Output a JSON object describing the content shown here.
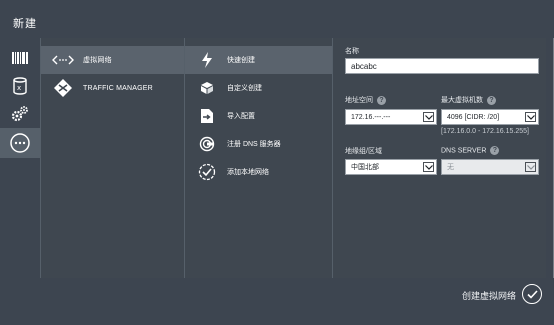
{
  "window": {
    "title": "新建"
  },
  "sidebar_icons": [
    {
      "name": "barcode-icon",
      "active": false
    },
    {
      "name": "cylinder-icon",
      "active": false
    },
    {
      "name": "gears-icon",
      "active": false
    },
    {
      "name": "network-dots-icon",
      "active": true
    }
  ],
  "nav": {
    "items": [
      {
        "label": "虚拟网络",
        "icon": "network-arrows-icon",
        "active": true
      },
      {
        "label": "TRAFFIC MANAGER",
        "icon": "traffic-manager-icon",
        "active": false
      }
    ]
  },
  "actions": {
    "items": [
      {
        "label": "快速创建",
        "icon": "lightning-icon",
        "active": true
      },
      {
        "label": "自定义创建",
        "icon": "box-icon",
        "active": false
      },
      {
        "label": "导入配置",
        "icon": "import-icon",
        "active": false
      },
      {
        "label": "注册 DNS 服务器",
        "icon": "dns-icon",
        "active": false
      },
      {
        "label": "添加本地网络",
        "icon": "check-circle-icon",
        "active": false
      }
    ]
  },
  "form": {
    "name_label": "名称",
    "name_value": "abcabc",
    "address_space_label": "地址空间",
    "address_space_value": "172.16.---.---",
    "max_vms_label": "最大虚拟机数",
    "max_vms_value": "4096 [CIDR: /20]",
    "range_hint": "[172.16.0.0 - 172.16.15.255]",
    "region_label": "地缘组/区域",
    "region_value": "中国北部",
    "dns_label": "DNS SERVER",
    "dns_value": "无",
    "help_glyph": "?"
  },
  "footer": {
    "create_label": "创建虚拟网络"
  },
  "colors": {
    "background": "#3f4750",
    "active_item": "#5a636d",
    "panel_border": "#56606a"
  }
}
